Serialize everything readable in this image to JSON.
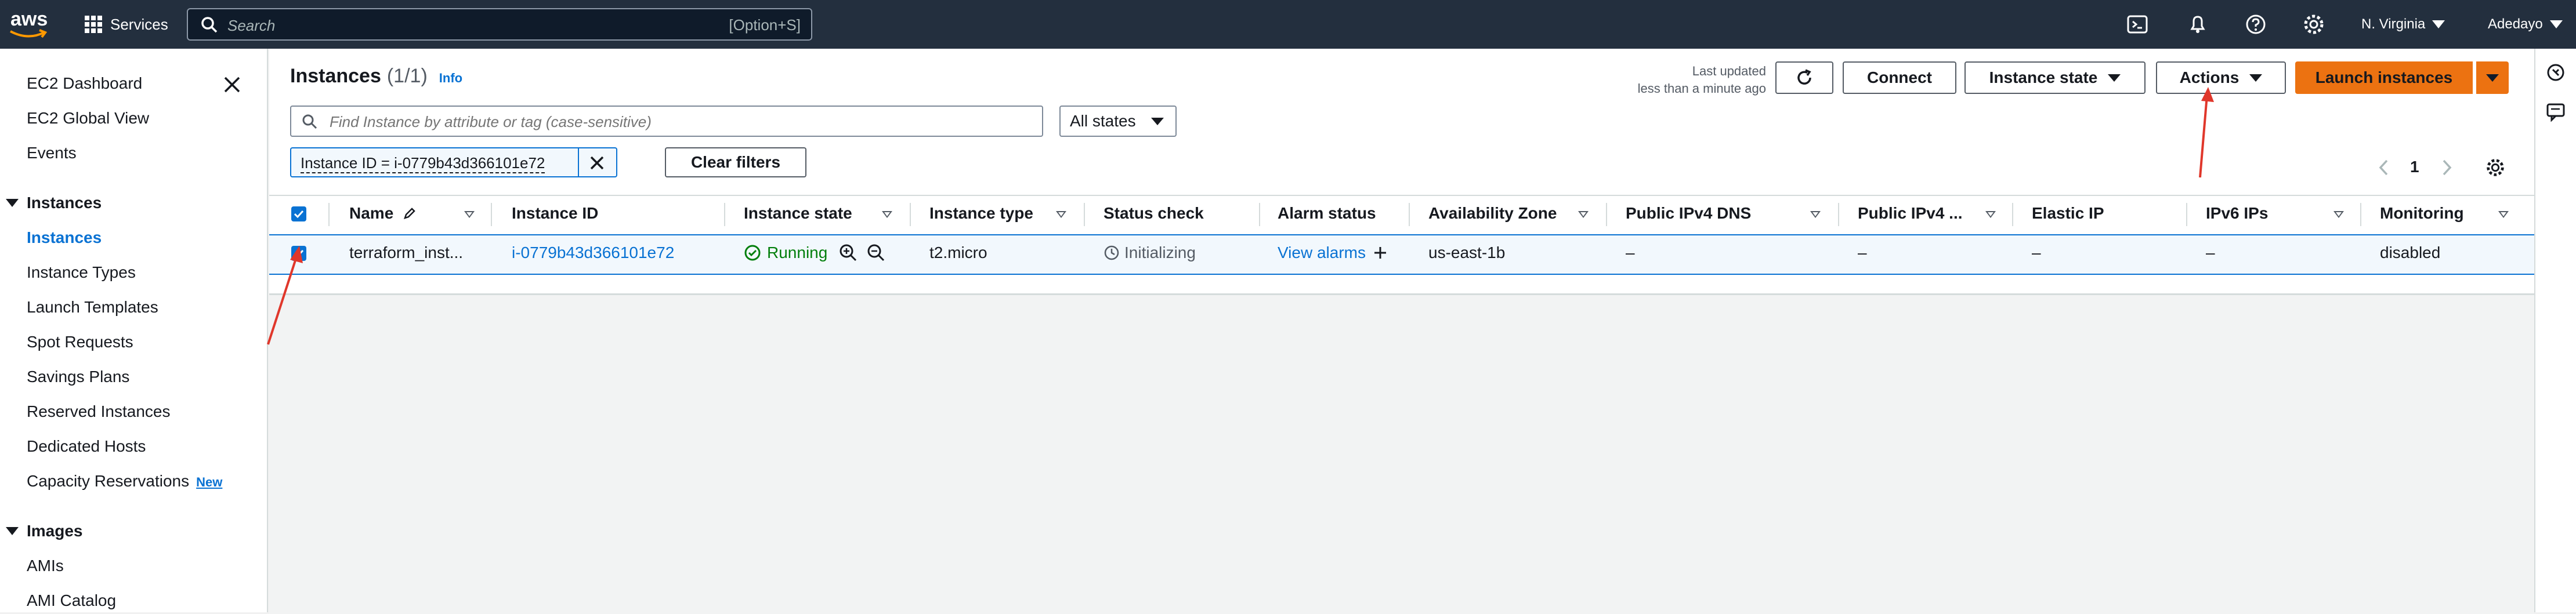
{
  "nav": {
    "logo": "aws",
    "services_label": "Services",
    "search_placeholder": "Search",
    "search_shortcut": "[Option+S]",
    "region": "N. Virginia",
    "user": "Adedayo",
    "icons": [
      "cloudshell-icon",
      "bell-icon",
      "help-icon",
      "gear-icon"
    ]
  },
  "sidebar": {
    "top_links": [
      "EC2 Dashboard",
      "EC2 Global View",
      "Events"
    ],
    "sections": [
      {
        "title": "Instances",
        "items": [
          "Instances",
          "Instance Types",
          "Launch Templates",
          "Spot Requests",
          "Savings Plans",
          "Reserved Instances",
          "Dedicated Hosts",
          "Capacity Reservations"
        ]
      },
      {
        "title": "Images",
        "items": [
          "AMIs",
          "AMI Catalog"
        ]
      }
    ],
    "active_item": "Instances",
    "new_badge": "New"
  },
  "header": {
    "title": "Instances",
    "count": "(1/1)",
    "info": "Info",
    "last_updated_line1": "Last updated",
    "last_updated_line2": "less than a minute ago",
    "connect": "Connect",
    "instance_state": "Instance state",
    "actions": "Actions",
    "launch": "Launch instances"
  },
  "filters": {
    "search_placeholder": "Find Instance by attribute or tag (case-sensitive)",
    "states_select": "All states",
    "token": "Instance ID = i-0779b43d366101e72",
    "clear_filters": "Clear filters",
    "page_number": "1"
  },
  "table": {
    "columns": [
      "Name",
      "Instance ID",
      "Instance state",
      "Instance type",
      "Status check",
      "Alarm status",
      "Availability Zone",
      "Public IPv4 DNS",
      "Public IPv4 ...",
      "Elastic IP",
      "IPv6 IPs",
      "Monitoring"
    ],
    "rows": [
      {
        "name": "terraform_inst...",
        "instance_id": "i-0779b43d366101e72",
        "state": "Running",
        "type": "t2.micro",
        "status_check": "Initializing",
        "alarm": "View alarms",
        "az": "us-east-1b",
        "dns": "–",
        "ipv4": "–",
        "eip": "–",
        "ipv6": "–",
        "monitoring": "disabled"
      }
    ]
  },
  "colors": {
    "nav_bg": "#232f3e",
    "accent": "#0972d3",
    "launch": "#ec7211",
    "running": "#037f0c",
    "annotation": "#e0372b"
  }
}
